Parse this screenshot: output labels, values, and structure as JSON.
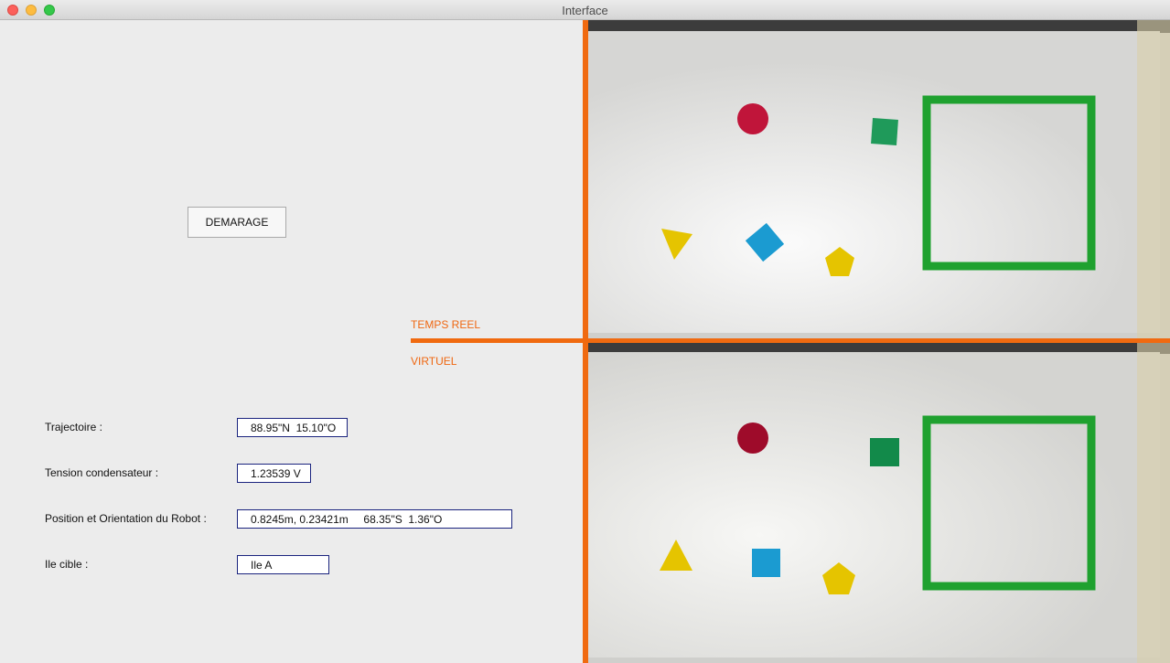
{
  "window": {
    "title": "Interface"
  },
  "controls": {
    "start_label": "DEMARAGE"
  },
  "views": {
    "realtime_label": "TEMPS REEL",
    "virtual_label": "VIRTUEL"
  },
  "fields": [
    {
      "label": "Trajectoire :",
      "value": "88.95\"N  15.10\"O"
    },
    {
      "label": "Tension condensateur :",
      "value": "1.23539 V"
    },
    {
      "label": "Position et Orientation du Robot :",
      "value": "0.8245m, 0.23421m     68.35\"S  1.36\"O"
    },
    {
      "label": "Ile cible :",
      "value": "Ile A"
    }
  ],
  "colors": {
    "accent": "#f06a10",
    "field_border": "#1a237e",
    "zone_green": "#1fa12f",
    "red_circle": "#c0153a",
    "green_square": "#1f9a5a",
    "blue_square": "#1b9bd1",
    "yellow_shape": "#e5c400"
  },
  "icons": [
    "close-icon",
    "minimize-icon",
    "maximize-icon"
  ]
}
